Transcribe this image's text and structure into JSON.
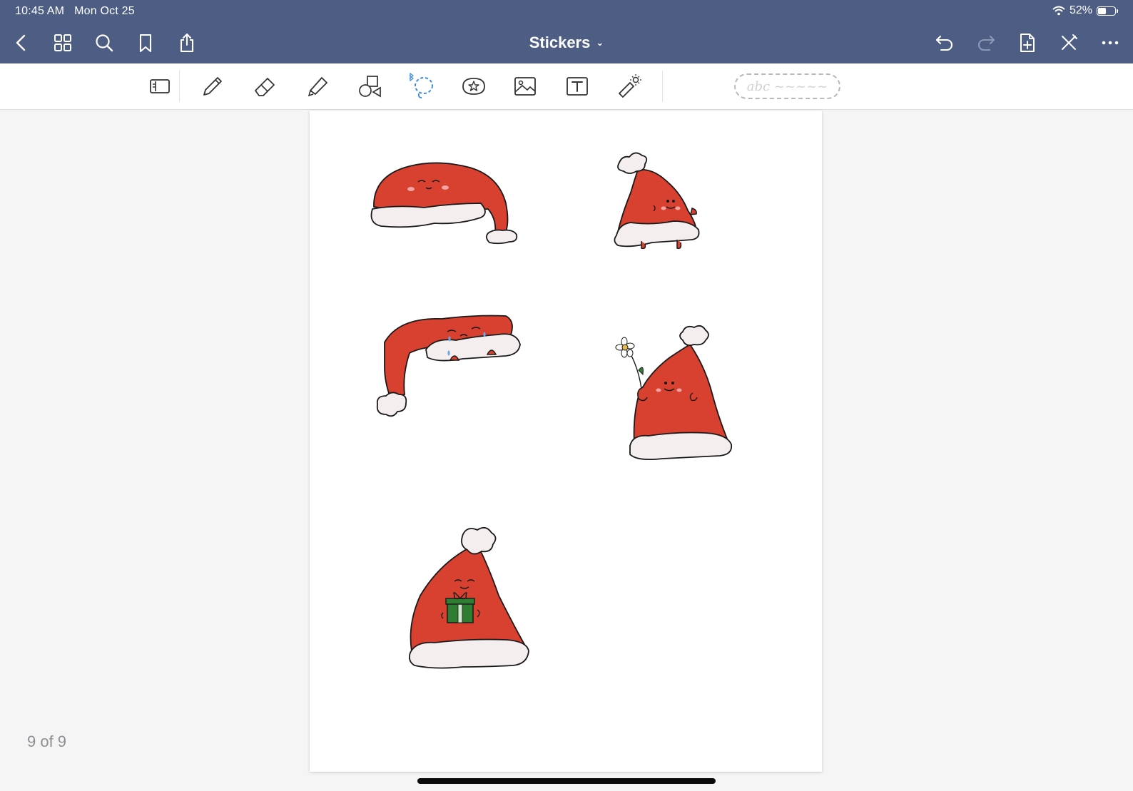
{
  "status": {
    "time": "10:45 AM",
    "date": "Mon Oct 25",
    "battery": "52%",
    "battery_level": 0.52
  },
  "header": {
    "title": "Stickers",
    "title_chevron": "⌄"
  },
  "toolbar": {
    "tools": [
      "read-only-mode-icon",
      "pen-icon",
      "eraser-icon",
      "highlighter-icon",
      "shapes-icon",
      "lasso-icon",
      "sticker-icon",
      "image-icon",
      "text-icon",
      "laser-pointer-icon"
    ],
    "active_tool": "lasso-icon",
    "active_color": "#3b8fde",
    "inspector_placeholder": "abc ~~~~~"
  },
  "stickers": [
    {
      "name": "santa-hat-sleepy"
    },
    {
      "name": "santa-hat-walking"
    },
    {
      "name": "santa-hat-crying"
    },
    {
      "name": "santa-hat-flower"
    },
    {
      "name": "santa-hat-gift"
    }
  ],
  "colors": {
    "hat_red": "#d8402f",
    "fur_white": "#f4eeee",
    "topbar": "#4e5d84",
    "gift_green": "#2e7d32"
  },
  "footer": {
    "page_indicator": "9 of 9"
  }
}
